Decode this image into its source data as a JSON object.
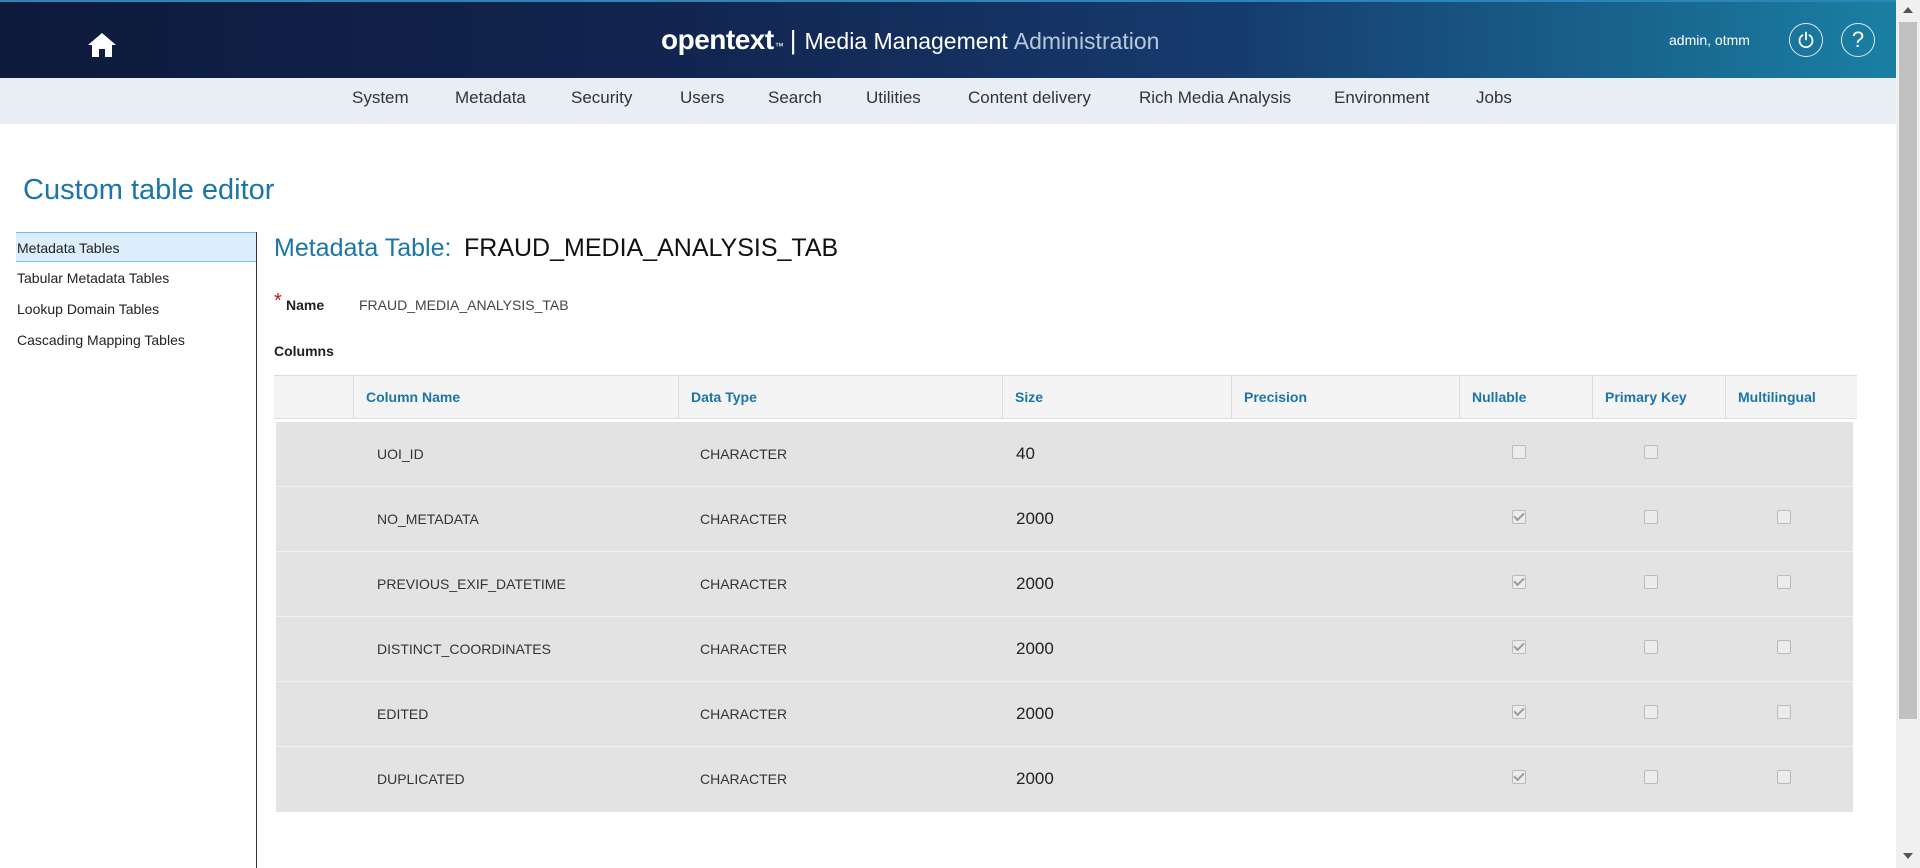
{
  "header": {
    "logo": "opentext",
    "logo_tm": "™",
    "separator": "|",
    "product": "Media Management",
    "section": "Administration",
    "user": "admin, otmm",
    "help_symbol": "?"
  },
  "nav": {
    "items": [
      "System",
      "Metadata",
      "Security",
      "Users",
      "Search",
      "Utilities",
      "Content delivery",
      "Rich Media Analysis",
      "Environment",
      "Jobs"
    ]
  },
  "page": {
    "title": "Custom table editor"
  },
  "sidebar": {
    "items": [
      {
        "label": "Metadata Tables",
        "active": true
      },
      {
        "label": "Tabular Metadata Tables"
      },
      {
        "label": "Lookup Domain Tables"
      },
      {
        "label": "Cascading Mapping Tables"
      }
    ]
  },
  "content": {
    "metadata_table_label": "Metadata Table:",
    "metadata_table_value": "FRAUD_MEDIA_ANALYSIS_TAB",
    "required_marker": "*",
    "name_label": "Name",
    "name_value": "FRAUD_MEDIA_ANALYSIS_TAB",
    "columns_label": "Columns"
  },
  "table": {
    "headers": [
      "Column Name",
      "Data Type",
      "Size",
      "Precision",
      "Nullable",
      "Primary Key",
      "Multilingual"
    ],
    "rows": [
      {
        "name": "UOI_ID",
        "type": "CHARACTER",
        "size": "40",
        "nullable": false,
        "primary_key": false,
        "multilingual": null
      },
      {
        "name": "NO_METADATA",
        "type": "CHARACTER",
        "size": "2000",
        "nullable": true,
        "primary_key": false,
        "multilingual": false
      },
      {
        "name": "PREVIOUS_EXIF_DATETIME",
        "type": "CHARACTER",
        "size": "2000",
        "nullable": true,
        "primary_key": false,
        "multilingual": false
      },
      {
        "name": "DISTINCT_COORDINATES",
        "type": "CHARACTER",
        "size": "2000",
        "nullable": true,
        "primary_key": false,
        "multilingual": false
      },
      {
        "name": "EDITED",
        "type": "CHARACTER",
        "size": "2000",
        "nullable": true,
        "primary_key": false,
        "multilingual": false
      },
      {
        "name": "DUPLICATED",
        "type": "CHARACTER",
        "size": "2000",
        "nullable": true,
        "primary_key": false,
        "multilingual": false
      }
    ]
  },
  "colors": {
    "accent": "#1b75a9",
    "header_dark": "#0d1a3c",
    "header_light": "#1a7fa3",
    "nav_bg": "#e8eef3",
    "row_bg": "#e3e3e3",
    "required": "#c0141a"
  },
  "icons": {
    "home": "home-icon",
    "power": "power-icon",
    "help": "help-icon"
  }
}
